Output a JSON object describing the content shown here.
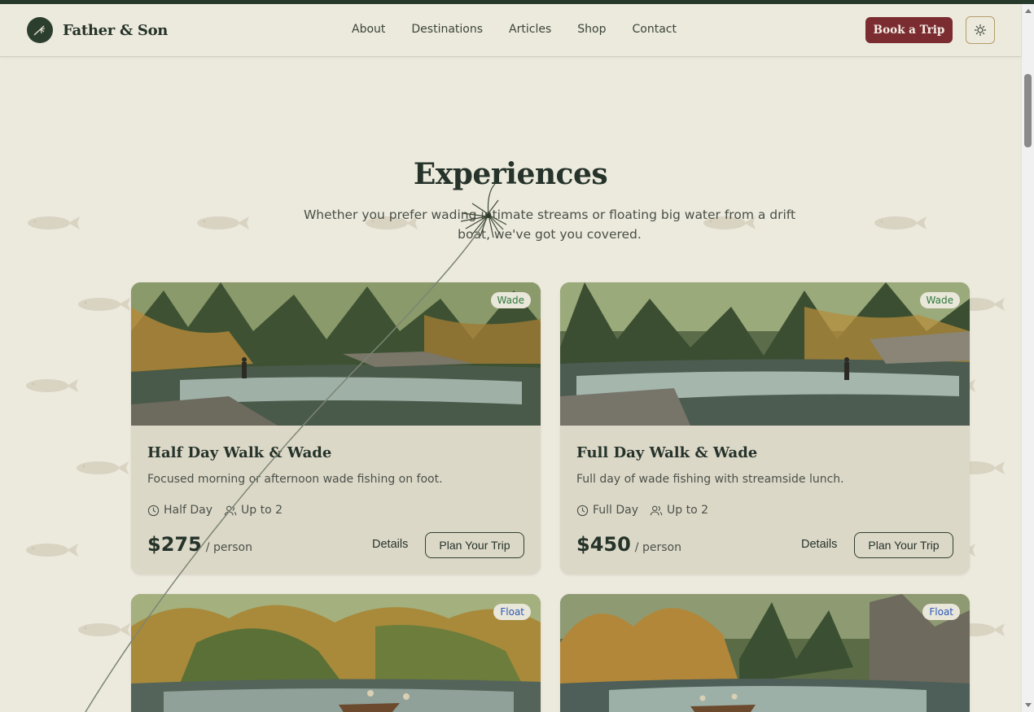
{
  "header": {
    "brand": "Father & Son",
    "nav": [
      "About",
      "Destinations",
      "Articles",
      "Shop",
      "Contact"
    ],
    "book_label": "Book a Trip",
    "logo_icon": "fly-rod-icon",
    "theme_icon": "sun-icon"
  },
  "section": {
    "title": "Experiences",
    "subtitle": "Whether you prefer wading intimate streams or floating big water from a drift boat, we've got you covered."
  },
  "cards": [
    {
      "tag": "Wade",
      "title": "Half Day Walk & Wade",
      "description": "Focused morning or afternoon wade fishing on foot.",
      "duration": "Half Day",
      "group": "Up to 2",
      "price": "$275",
      "unit": "/ person",
      "details_label": "Details",
      "plan_label": "Plan Your Trip"
    },
    {
      "tag": "Wade",
      "title": "Full Day Walk & Wade",
      "description": "Full day of wade fishing with streamside lunch.",
      "duration": "Full Day",
      "group": "Up to 2",
      "price": "$450",
      "unit": "/ person",
      "details_label": "Details",
      "plan_label": "Plan Your Trip"
    },
    {
      "tag": "Float"
    },
    {
      "tag": "Float"
    }
  ],
  "colors": {
    "accent": "#7a2c31",
    "forest": "#26392a",
    "background": "#ece9dd",
    "card": "#dcd8c8",
    "wade_tag": "#2f7a3c",
    "float_tag": "#2d5ab8"
  }
}
